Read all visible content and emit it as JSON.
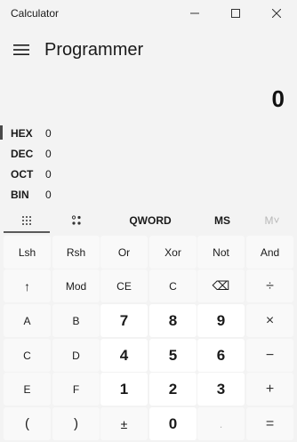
{
  "window": {
    "title": "Calculator",
    "controls": [
      "minimize-icon",
      "maximize-icon",
      "close-icon"
    ]
  },
  "header": {
    "mode": "Programmer",
    "menu_icon": "hamburger-icon"
  },
  "display": {
    "value": "0"
  },
  "radix": [
    {
      "name": "HEX",
      "value": "0",
      "active": true
    },
    {
      "name": "DEC",
      "value": "0",
      "active": false
    },
    {
      "name": "OCT",
      "value": "0",
      "active": false
    },
    {
      "name": "BIN",
      "value": "0",
      "active": false
    }
  ],
  "toolbar": {
    "keypad_icon": "full-keypad-icon",
    "bitflip_icon": "bit-toggle-icon",
    "word_size": "QWORD",
    "ms": "MS",
    "mplus": "M˅"
  },
  "keys": {
    "row1": [
      "Lsh",
      "Rsh",
      "Or",
      "Xor",
      "Not",
      "And"
    ],
    "row2": [
      "↑",
      "Mod",
      "CE",
      "C",
      "⌫",
      "÷"
    ],
    "row3": [
      "A",
      "B",
      "7",
      "8",
      "9",
      "×"
    ],
    "row4": [
      "C",
      "D",
      "4",
      "5",
      "6",
      "−"
    ],
    "row5": [
      "E",
      "F",
      "1",
      "2",
      "3",
      "+"
    ],
    "row6": [
      "(",
      ")",
      "±",
      "0",
      ".",
      "="
    ]
  }
}
